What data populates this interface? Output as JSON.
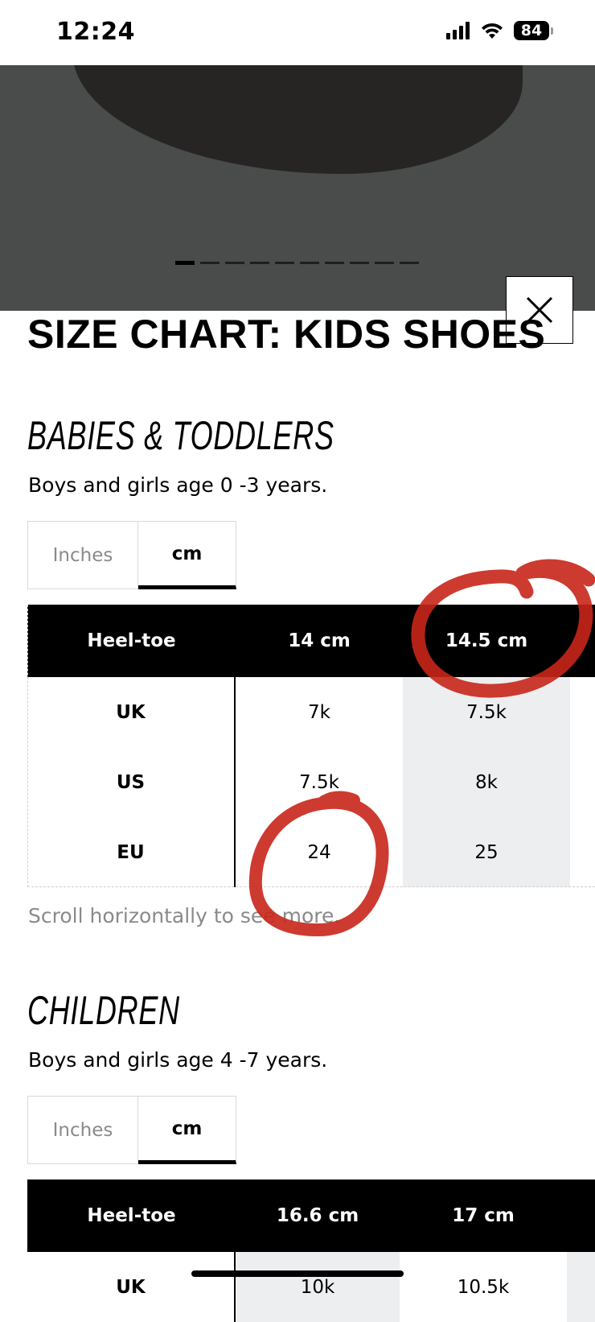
{
  "status": {
    "time": "12:24",
    "battery": "84"
  },
  "hero": {
    "dots_count": 10,
    "active_dot": 0
  },
  "modal": {
    "title": "SIZE CHART: KIDS SHOES",
    "close_icon": "close-icon"
  },
  "sections": [
    {
      "heading": "BABIES & TODDLERS",
      "subtitle": "Boys and girls age 0 -3 years.",
      "units": [
        "Inches",
        "cm"
      ],
      "active_unit": "cm",
      "table": {
        "header": [
          "Heel-toe",
          "14 cm",
          "14.5 cm"
        ],
        "rows": [
          {
            "label": "UK",
            "values": [
              "7k",
              "7.5k"
            ]
          },
          {
            "label": "US",
            "values": [
              "7.5k",
              "8k"
            ]
          },
          {
            "label": "EU",
            "values": [
              "24",
              "25"
            ]
          }
        ]
      },
      "hint": "Scroll horizontally to see more."
    },
    {
      "heading": "CHILDREN",
      "subtitle": "Boys and girls age 4 -7 years.",
      "units": [
        "Inches",
        "cm"
      ],
      "active_unit": "cm",
      "table": {
        "header": [
          "Heel-toe",
          "16.6 cm",
          "17 cm"
        ],
        "rows": [
          {
            "label": "UK",
            "values": [
              "10k",
              "10.5k"
            ]
          }
        ]
      }
    }
  ],
  "colors": {
    "highlight_column": "#eceef0",
    "annotation_red": "#c8261a",
    "hero_bg": "#4a4b4b"
  }
}
